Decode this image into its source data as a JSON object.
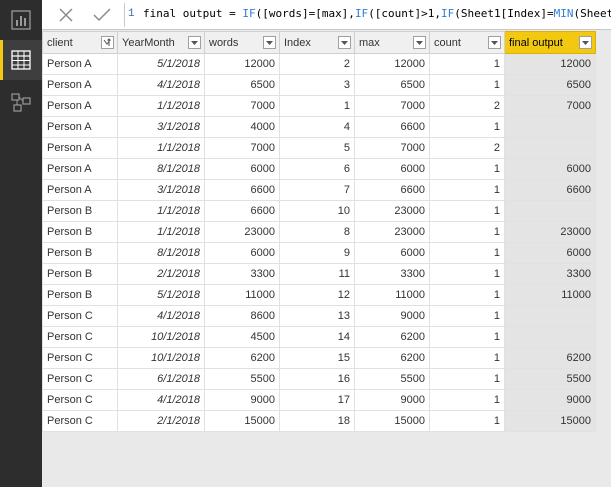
{
  "formula": {
    "line_number": "1",
    "text_plain_1": "final output = ",
    "kw_if_1": "IF",
    "text_plain_2": "([words]=[max],",
    "kw_if_2": "IF",
    "text_plain_3": "([count]>1,",
    "kw_if_3": "IF",
    "text_plain_4": "(Sheet1[Index]=",
    "kw_min": "MIN",
    "text_plain_5": "(Sheet"
  },
  "table": {
    "headers": [
      "client",
      "YearMonth",
      "words",
      "Index",
      "max",
      "count",
      "final output"
    ],
    "rows": [
      [
        "Person A",
        "5/1/2018",
        "12000",
        "2",
        "12000",
        "1",
        "12000"
      ],
      [
        "Person A",
        "4/1/2018",
        "6500",
        "3",
        "6500",
        "1",
        "6500"
      ],
      [
        "Person A",
        "1/1/2018",
        "7000",
        "1",
        "7000",
        "2",
        "7000"
      ],
      [
        "Person A",
        "3/1/2018",
        "4000",
        "4",
        "6600",
        "1",
        ""
      ],
      [
        "Person A",
        "1/1/2018",
        "7000",
        "5",
        "7000",
        "2",
        ""
      ],
      [
        "Person A",
        "8/1/2018",
        "6000",
        "6",
        "6000",
        "1",
        "6000"
      ],
      [
        "Person A",
        "3/1/2018",
        "6600",
        "7",
        "6600",
        "1",
        "6600"
      ],
      [
        "Person B",
        "1/1/2018",
        "6600",
        "10",
        "23000",
        "1",
        ""
      ],
      [
        "Person B",
        "1/1/2018",
        "23000",
        "8",
        "23000",
        "1",
        "23000"
      ],
      [
        "Person B",
        "8/1/2018",
        "6000",
        "9",
        "6000",
        "1",
        "6000"
      ],
      [
        "Person B",
        "2/1/2018",
        "3300",
        "11",
        "3300",
        "1",
        "3300"
      ],
      [
        "Person B",
        "5/1/2018",
        "11000",
        "12",
        "11000",
        "1",
        "11000"
      ],
      [
        "Person C",
        "4/1/2018",
        "8600",
        "13",
        "9000",
        "1",
        ""
      ],
      [
        "Person C",
        "10/1/2018",
        "4500",
        "14",
        "6200",
        "1",
        ""
      ],
      [
        "Person C",
        "10/1/2018",
        "6200",
        "15",
        "6200",
        "1",
        "6200"
      ],
      [
        "Person C",
        "6/1/2018",
        "5500",
        "16",
        "5500",
        "1",
        "5500"
      ],
      [
        "Person C",
        "4/1/2018",
        "9000",
        "17",
        "9000",
        "1",
        "9000"
      ],
      [
        "Person C",
        "2/1/2018",
        "15000",
        "18",
        "15000",
        "1",
        "15000"
      ]
    ]
  },
  "icons": {
    "nav": [
      "report-view-icon",
      "data-view-icon",
      "relationships-view-icon"
    ],
    "formula": [
      "cancel-icon",
      "commit-icon"
    ]
  },
  "colors": {
    "accent": "#f2c811",
    "sidebar": "#2d2d2d",
    "selected_column": "#e4e4e4"
  }
}
